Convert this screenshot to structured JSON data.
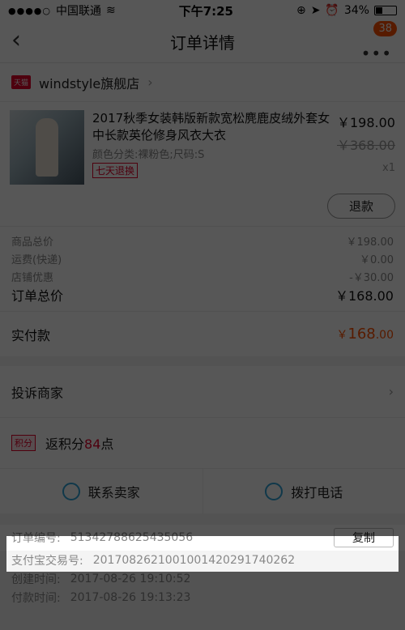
{
  "status": {
    "carrier": "中国联通",
    "time": "下午7:25",
    "battery": "34%",
    "battery_level": 0.34
  },
  "nav": {
    "title": "订单详情",
    "back": "‹",
    "more": "•••",
    "badge": "38"
  },
  "shop": {
    "tag": "天猫",
    "name": "windstyle旗舰店",
    "chevron": "›"
  },
  "item": {
    "title": "2017秋季女装韩版新款宽松麂鹿皮绒外套女中长款英伦修身风衣大衣",
    "sku": "颜色分类:裸粉色;尺码:S",
    "return_tag": "七天退换",
    "price": "￥198.00",
    "original_price": "￥368.00",
    "quantity": "x1"
  },
  "refund": {
    "label": "退款"
  },
  "summary": {
    "rows": [
      {
        "label": "商品总价",
        "value": "￥198.00"
      },
      {
        "label": "运费(快递)",
        "value": "￥0.00"
      },
      {
        "label": "店铺优惠",
        "value": "-￥30.00"
      }
    ],
    "total_label": "订单总价",
    "total_value": "￥168.00",
    "paid_label": "实付款",
    "paid_currency": "￥",
    "paid_int": "168",
    "paid_dec": ".00"
  },
  "complain": {
    "label": "投诉商家",
    "chevron": "›"
  },
  "points": {
    "tag": "积分",
    "prefix": "返积分",
    "value": "84",
    "suffix": "点"
  },
  "contact": {
    "seller": "联系卖家",
    "phone": "拨打电话"
  },
  "info": {
    "order_no_label": "订单编号:",
    "order_no": "51342788625435056",
    "copy": "复制",
    "alipay_label": "支付宝交易号:",
    "alipay": "2017082621001001420291740262",
    "created_label": "创建时间:",
    "created": "2017-08-26 19:10:52",
    "paid_label": "付款时间:",
    "paid": "2017-08-26 19:13:23"
  },
  "colors": {
    "accent": "#ff5000",
    "tmall_red": "#e4002b",
    "icon_blue": "#31a3d9"
  }
}
